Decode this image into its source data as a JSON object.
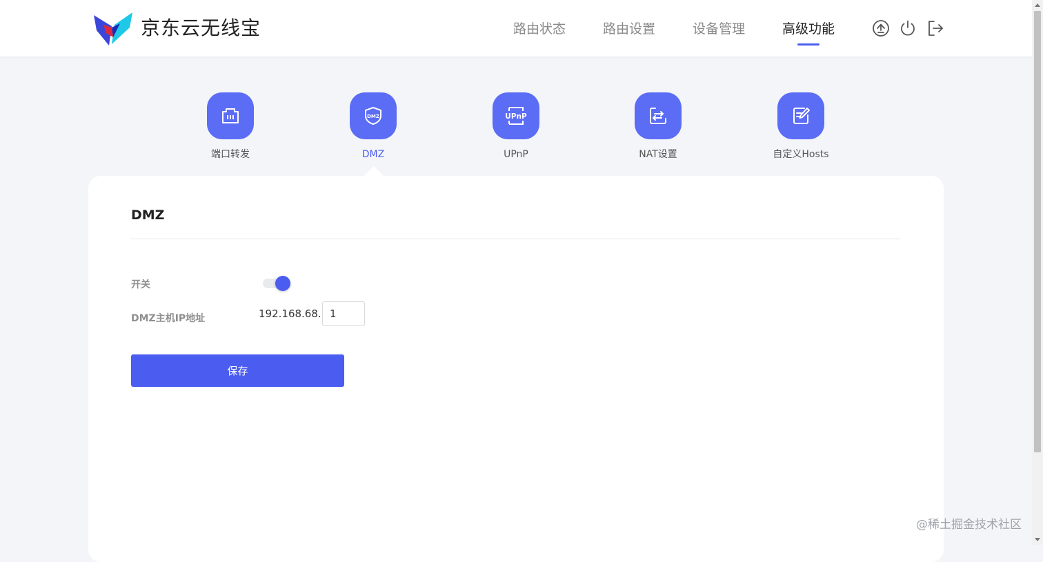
{
  "header": {
    "brand": "京东云无线宝",
    "nav": [
      {
        "label": "路由状态",
        "active": false
      },
      {
        "label": "路由设置",
        "active": false
      },
      {
        "label": "设备管理",
        "active": false
      },
      {
        "label": "高级功能",
        "active": true
      }
    ],
    "icons": [
      "upgrade-icon",
      "power-icon",
      "logout-icon"
    ]
  },
  "features": [
    {
      "label": "端口转发",
      "icon": "port-forward-icon",
      "active": false
    },
    {
      "label": "DMZ",
      "icon": "dmz-shield-icon",
      "active": true
    },
    {
      "label": "UPnP",
      "icon": "upnp-icon",
      "active": false
    },
    {
      "label": "NAT设置",
      "icon": "nat-icon",
      "active": false
    },
    {
      "label": "自定义Hosts",
      "icon": "edit-hosts-icon",
      "active": false
    }
  ],
  "card": {
    "title": "DMZ",
    "switch_label": "开关",
    "switch_on": true,
    "host_ip_label": "DMZ主机IP地址",
    "ip_prefix": "192.168.68.",
    "ip_suffix": "1",
    "save_label": "保存"
  },
  "watermark": "@稀土掘金技术社区",
  "colors": {
    "accent": "#4b5cf0",
    "icon_bg": "#5b6cf5",
    "page_bg": "#f3f5f9"
  }
}
